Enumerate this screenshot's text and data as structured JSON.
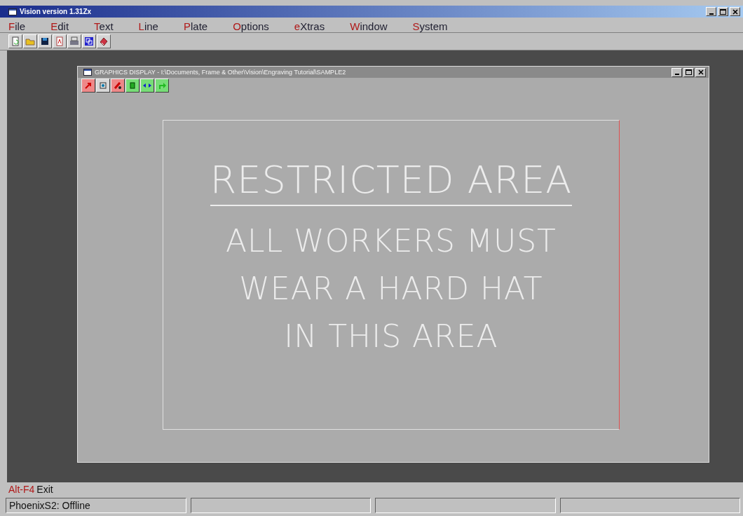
{
  "window": {
    "title": "Vision version 1.31Zx"
  },
  "menu": [
    "File",
    "Edit",
    "Text",
    "Line",
    "Plate",
    "Options",
    "eXtras",
    "Window",
    "System"
  ],
  "child_window": {
    "title": "GRAPHICS DISPLAY - I:\\Documents, Frame & Other\\Vision\\Engraving Tutorial\\SAMPLE2"
  },
  "plate": {
    "lines": [
      {
        "text": "RESTRICTED AREA",
        "underlined": true
      },
      {
        "text": "ALL WORKERS MUST",
        "underlined": false
      },
      {
        "text": "WEAR A HARD HAT",
        "underlined": false
      },
      {
        "text": "IN THIS AREA",
        "underlined": false
      }
    ]
  },
  "hint": {
    "key": "Alt-F4",
    "action": "Exit"
  },
  "status_bar": {
    "connection": "PhoenixS2: Offline"
  }
}
